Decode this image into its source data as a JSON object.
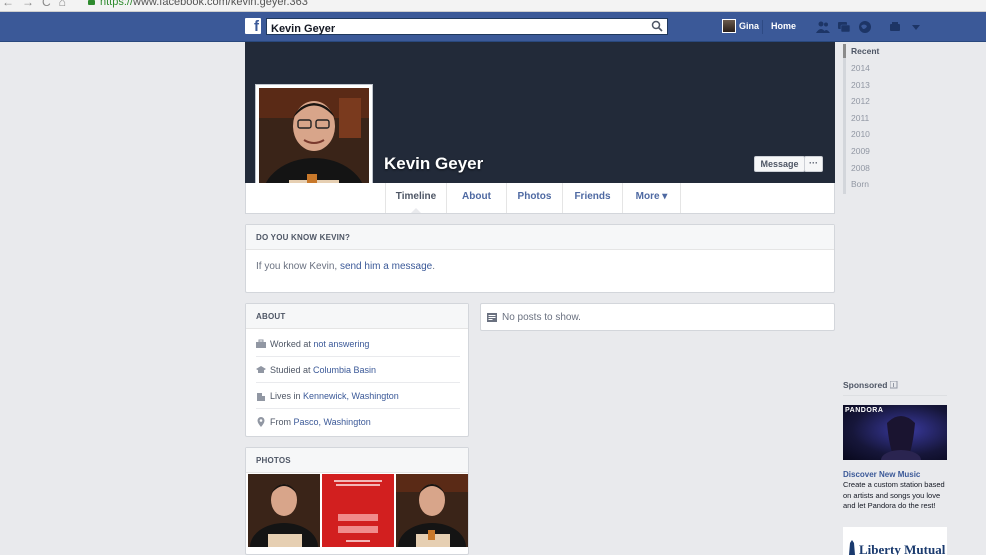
{
  "browser": {
    "url_secure_part": "https://",
    "url_rest": "www.facebook.com/kevin.geyer.363"
  },
  "topbar": {
    "search_value": "Kevin Geyer",
    "user_name": "Gina",
    "home_label": "Home"
  },
  "profile": {
    "name": "Kevin Geyer",
    "message_button": "Message",
    "more_button": "···"
  },
  "tabs": [
    {
      "label": "Timeline"
    },
    {
      "label": "About"
    },
    {
      "label": "Photos"
    },
    {
      "label": "Friends"
    },
    {
      "label": "More ▾"
    }
  ],
  "know_card": {
    "heading": "DO YOU KNOW KEVIN?",
    "text_before": "If you know Kevin, ",
    "link": "send him a message",
    "text_after": "."
  },
  "about": {
    "heading": "ABOUT",
    "rows": [
      {
        "prefix": "Worked at ",
        "link": "not answering",
        "icon": "briefcase-icon"
      },
      {
        "prefix": "Studied at ",
        "link": "Columbia Basin",
        "icon": "graduation-cap-icon"
      },
      {
        "prefix": "Lives in ",
        "link": "Kennewick, Washington",
        "icon": "house-icon"
      },
      {
        "prefix": "From ",
        "link": "Pasco, Washington",
        "icon": "location-pin-icon"
      }
    ]
  },
  "photos": {
    "heading": "PHOTOS"
  },
  "feed": {
    "no_posts": "No posts to show."
  },
  "timeline_years": [
    "Recent",
    "2014",
    "2013",
    "2012",
    "2011",
    "2010",
    "2009",
    "2008",
    "Born"
  ],
  "sponsored": {
    "heading": "Sponsored",
    "ad1": {
      "brand": "PANDORA",
      "title": "Discover New Music",
      "body": "Create a custom station based on artists and songs you love and let Pandora do the rest!"
    },
    "ad2": {
      "brand": "Liberty Mutual"
    }
  },
  "colors": {
    "facebook_blue": "#3b5998",
    "cover_dark": "#222a39",
    "page_bg": "#e9eaed"
  }
}
